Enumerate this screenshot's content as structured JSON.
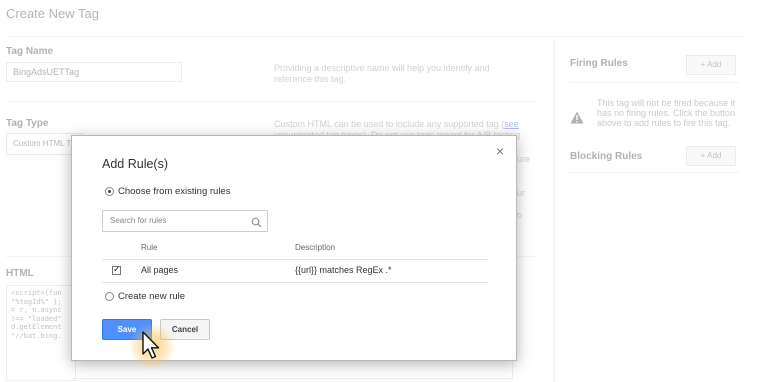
{
  "page": {
    "title": "Create New Tag",
    "tag_name_label": "Tag Name",
    "tag_name_value": "BingAdsUETTag",
    "tag_name_help": "Providing a descriptive name will help you identify and reference this tag.",
    "tag_type_label": "Tag Type",
    "tag_type_value": "Custom HTML T",
    "tag_type_help_prefix": "Custom HTML can be used to include any supported tag (",
    "tag_type_help_link": "see",
    "tag_type_help_line2": "unsupported tag types). Do not use tags meant for A/B testing",
    "tag_type_help_fragment_1": "ure",
    "tag_type_help_fragment_2": "ur",
    "tag_type_help_fragment_3": "o",
    "html_label": "HTML",
    "html_code": "<script>(fun\n\"%tagId%\" };\n= r, n.async\n!== \"loaded\"\nd.getElement\n\"//bat.bing.",
    "firing_rules_title": "Firing Rules",
    "firing_add_label": "+ Add",
    "firing_warning": "This tag will not be fired because it has no firing rules. Click the button above to add rules to fire this tag.",
    "blocking_rules_title": "Blocking Rules",
    "blocking_add_label": "+ Add"
  },
  "modal": {
    "title": "Add Rule(s)",
    "close_glyph": "×",
    "option_existing": "Choose from existing rules",
    "option_new": "Create new rule",
    "search_placeholder": "Search for rules",
    "table": {
      "col_rule": "Rule",
      "col_description": "Description",
      "rows": [
        {
          "checked": true,
          "rule": "All pages",
          "description": "{{url}} matches RegEx .*"
        }
      ]
    },
    "save_label": "Save",
    "cancel_label": "Cancel"
  },
  "colors": {
    "primary_button": "#4d90fe",
    "cursor_highlight": "#ffbe50"
  },
  "icons": [
    "close-icon",
    "search-icon",
    "warning-icon",
    "pointer-cursor-icon"
  ]
}
